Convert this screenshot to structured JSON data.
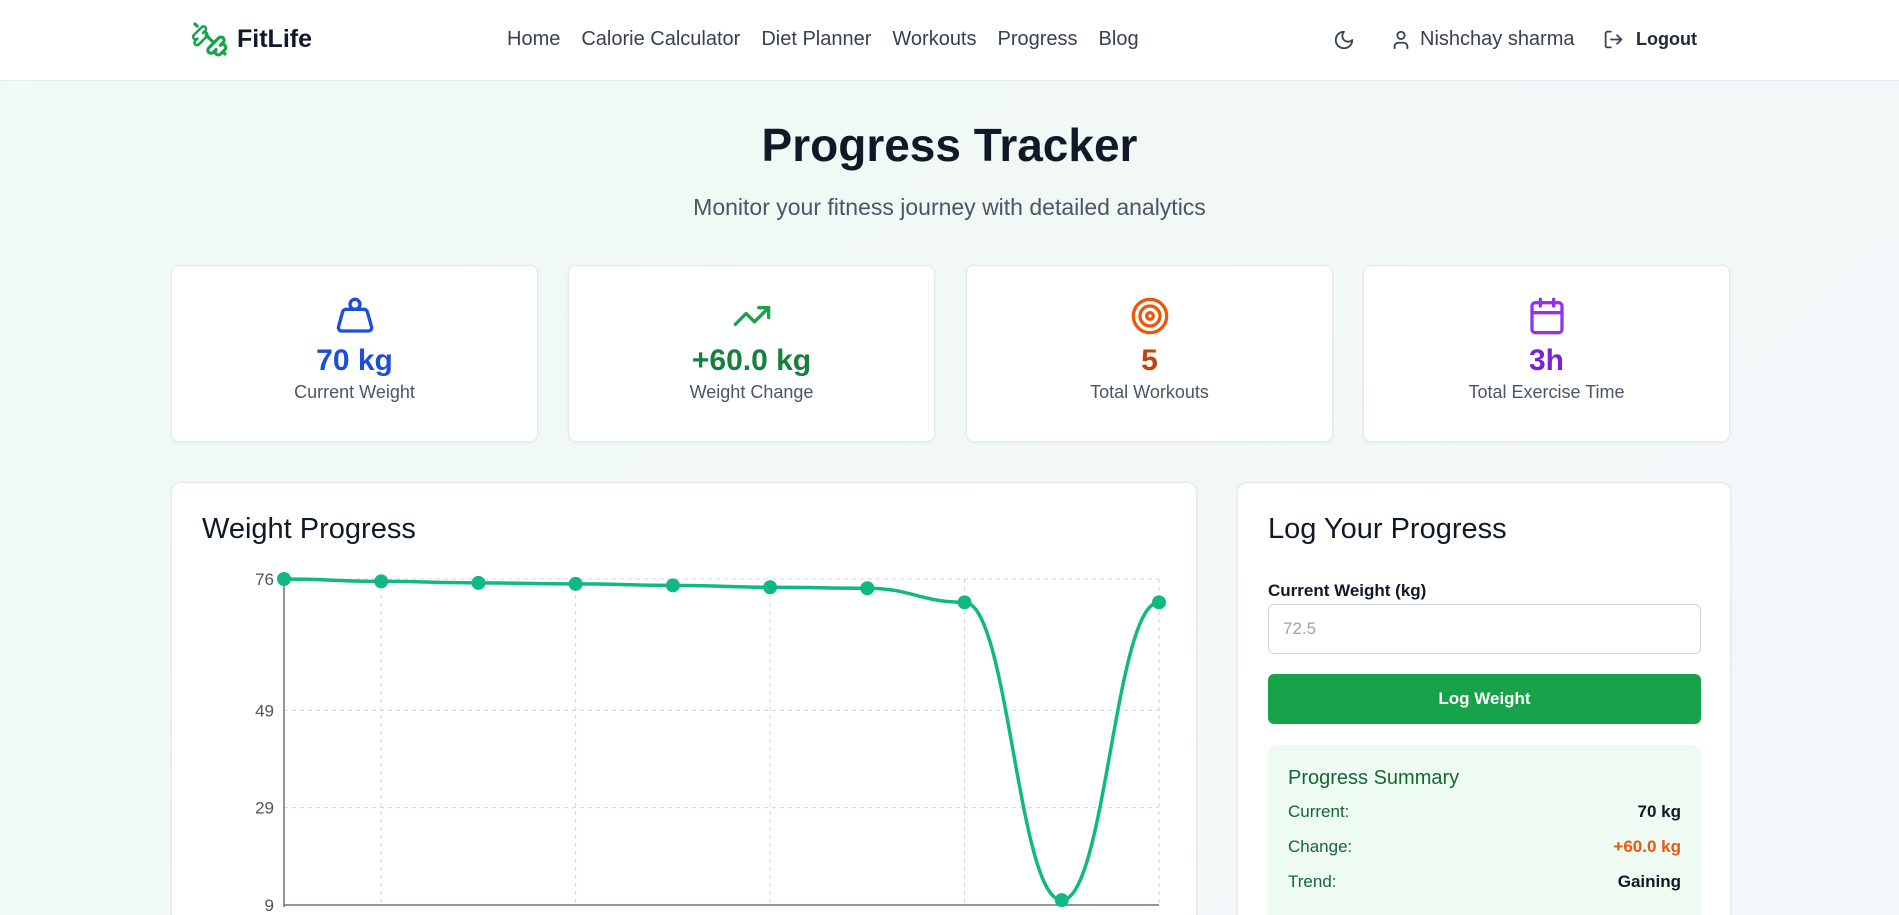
{
  "header": {
    "brand": "FitLife",
    "nav": [
      "Home",
      "Calorie Calculator",
      "Diet Planner",
      "Workouts",
      "Progress",
      "Blog"
    ],
    "user_name": "Nishchay sharma",
    "logout_label": "Logout",
    "icons": {
      "brand": "dumbbell-icon",
      "theme": "moon-icon",
      "user": "user-icon",
      "logout": "logout-icon"
    }
  },
  "hero": {
    "title": "Progress Tracker",
    "subtitle": "Monitor your fitness journey with detailed analytics"
  },
  "stats": [
    {
      "value": "70 kg",
      "label": "Current Weight",
      "icon": "weight-icon",
      "color": "#1d4ed8"
    },
    {
      "value": "+60.0 kg",
      "label": "Weight Change",
      "icon": "trending-up-icon",
      "color": "#15803d"
    },
    {
      "value": "5",
      "label": "Total Workouts",
      "icon": "target-icon",
      "color": "#c2410c"
    },
    {
      "value": "3h",
      "label": "Total Exercise Time",
      "icon": "calendar-icon",
      "color": "#7e22ce"
    }
  ],
  "weight_progress": {
    "title": "Weight Progress",
    "chart_data": {
      "type": "line",
      "y_ticks": [
        9,
        29,
        49,
        76
      ],
      "ylim": [
        9,
        76
      ],
      "values": [
        76,
        75.5,
        75.2,
        75.0,
        74.7,
        74.3,
        74.1,
        71.2,
        10,
        71.2
      ],
      "color": "#10b981",
      "grid": true
    }
  },
  "log": {
    "title": "Log Your Progress",
    "weight_label": "Current Weight (kg)",
    "weight_placeholder": "72.5",
    "button_label": "Log Weight",
    "summary": {
      "title": "Progress Summary",
      "rows": [
        {
          "key": "Current:",
          "value": "70 kg",
          "color": "#111827"
        },
        {
          "key": "Change:",
          "value": "+60.0 kg",
          "color": "#ea580c"
        },
        {
          "key": "Trend:",
          "value": "Gaining",
          "color": "#111827"
        }
      ]
    }
  }
}
